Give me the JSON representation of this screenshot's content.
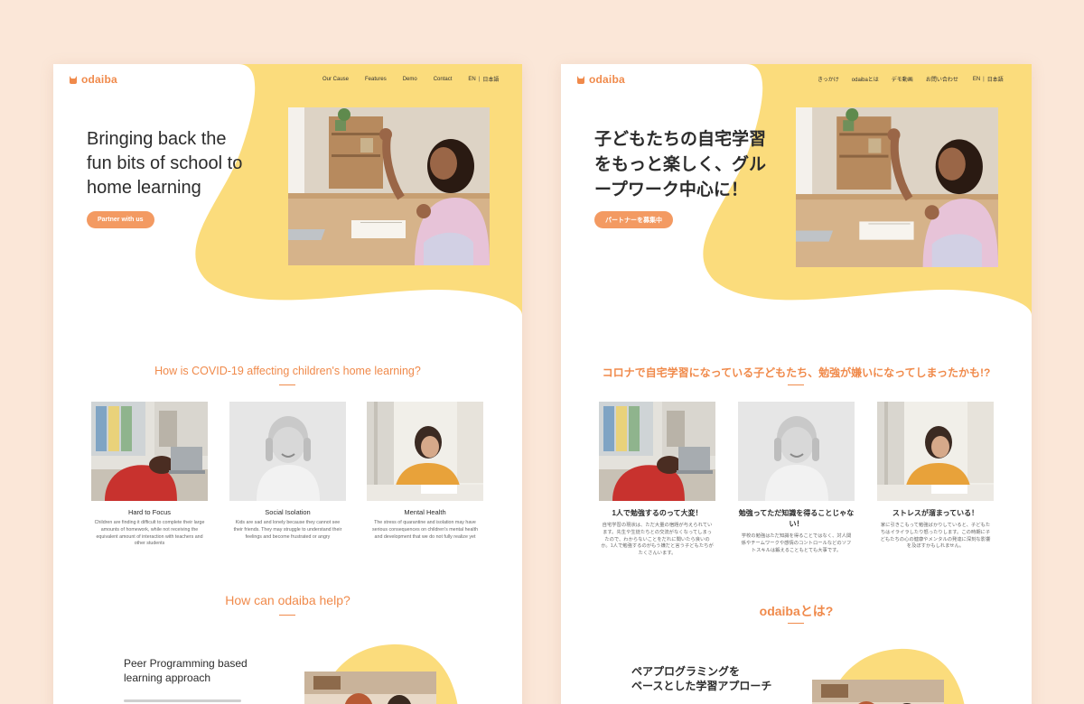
{
  "colors": {
    "background": "#fbe7d8",
    "accent": "#f08a4b",
    "button": "#f39a62",
    "blob": "#fbdc7c"
  },
  "en": {
    "logo": "odaiba",
    "nav": [
      "Our Cause",
      "Features",
      "Demo",
      "Contact"
    ],
    "lang": {
      "en": "EN",
      "sep": "|",
      "ja": "日本語"
    },
    "hero": {
      "title_lines": [
        "Bringing back the",
        "fun bits of school to",
        "home learning"
      ],
      "cta": "Partner with us"
    },
    "covid_title": "How is COVID-19 affecting children's home learning?",
    "cards": [
      {
        "title": "Hard to Focus",
        "text": "Children are finding it difficult to complete their large amounts of homework, while not receiving the equivalent amount of interaction with teachers and other students"
      },
      {
        "title": "Social Isolation",
        "text": "Kids are sad and lonely because they cannot see their friends. They may struggle to understand their feelings and become frustrated or angry"
      },
      {
        "title": "Mental Health",
        "text": "The stress of quarantine and isolation may have serious consequences on children's mental health and development that we do not fully realize yet"
      }
    ],
    "help_title": "How can odaiba help?",
    "peer_title_lines": [
      "Peer Programming based",
      "learning approach"
    ]
  },
  "ja": {
    "logo": "odaiba",
    "nav": [
      "きっかけ",
      "odaibaとは",
      "デモ動画",
      "お問い合わせ"
    ],
    "lang": {
      "en": "EN",
      "sep": "|",
      "ja": "日本語"
    },
    "hero": {
      "title_lines": [
        "子どもたちの自宅学習",
        "をもっと楽しく、グル",
        "ープワーク中心に！"
      ],
      "cta": "パートナーを募集中"
    },
    "covid_title": "コロナで自宅学習になっている子どもたち、勉強が嫌いになってしまったかも!?",
    "cards": [
      {
        "title": "1人で勉強するのって大変！",
        "text": "自宅学習の現状は、ただ大量の宿題が与えられています。先生や生徒たちとの交流がなくなってしまったので、わからないことをだれに聞いたら良いのか。1人で勉強するのがもう嫌だと言う子どもたちがたくさんいます。"
      },
      {
        "title": "勉強ってただ知識を得ることじゃない！",
        "text": "学校の勉強はただ知識を得ることではなく、対人関係やチームワークや感情のコントロールなどのソフトスキルは鍛えることもとても大事です。"
      },
      {
        "title": "ストレスが溜まっている！",
        "text": "家に引きこもって勉強ばかりしていると、子どもたちはイライラしたり怒ったりします。この時期に子どもたちの心の健康やメンタルの発達に深刻な影響を及ぼすかもしれません。"
      }
    ],
    "help_title": "odaibaとは?",
    "peer_title_lines": [
      "ペアプログラミングを",
      "ベースとした学習アプローチ"
    ]
  }
}
